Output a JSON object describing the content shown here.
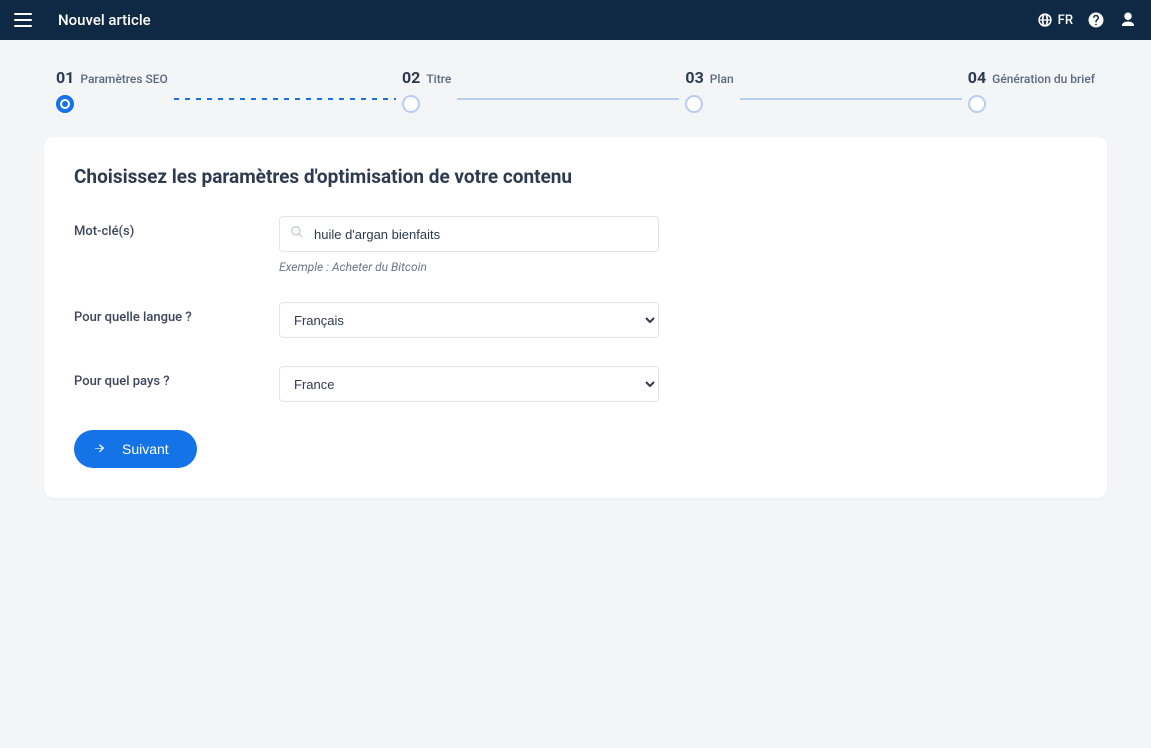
{
  "header": {
    "title": "Nouvel article",
    "lang_label": "FR"
  },
  "stepper": {
    "steps": [
      {
        "num": "01",
        "label": "Paramètres SEO"
      },
      {
        "num": "02",
        "label": "Titre"
      },
      {
        "num": "03",
        "label": "Plan"
      },
      {
        "num": "04",
        "label": "Génération du brief"
      }
    ]
  },
  "card": {
    "title": "Choisissez les paramètres d'optimisation de votre contenu",
    "keyword_label": "Mot-clé(s)",
    "keyword_value": "huile d'argan bienfaits",
    "keyword_help": "Exemple : Acheter du Bitcoin",
    "language_label": "Pour quelle langue ?",
    "language_value": "Français",
    "country_label": "Pour quel pays ?",
    "country_value": "France",
    "next_label": "Suivant"
  }
}
